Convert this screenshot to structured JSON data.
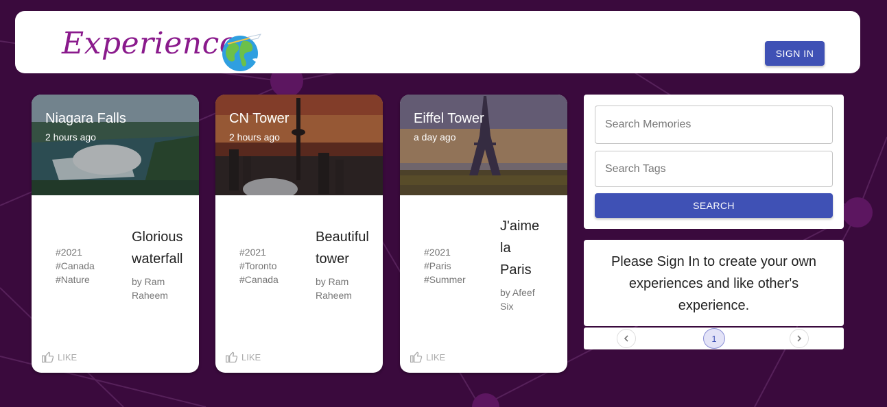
{
  "header": {
    "logo_text": "Experiences",
    "sign_in_label": "SIGN IN"
  },
  "posts": [
    {
      "title": "Niagara Falls",
      "time": "2 hours ago",
      "tags": [
        "#2021",
        "#Canada",
        "#Nature"
      ],
      "message_lines": [
        "Glorious",
        "waterfall"
      ],
      "author_lines": [
        "by Ram",
        "Raheem"
      ],
      "like_label": "LIKE"
    },
    {
      "title": "CN Tower",
      "time": "2 hours ago",
      "tags": [
        "#2021",
        "#Toronto",
        "#Canada"
      ],
      "message_lines": [
        "Beautiful",
        "tower"
      ],
      "author_lines": [
        "by Ram",
        "Raheem"
      ],
      "like_label": "LIKE"
    },
    {
      "title": "Eiffel Tower",
      "time": "a day ago",
      "tags": [
        "#2021",
        "#Paris",
        "#Summer"
      ],
      "message_lines": [
        "J'aime",
        "la",
        "Paris"
      ],
      "author_lines": [
        "by Afeef",
        "Six"
      ],
      "like_label": "LIKE"
    }
  ],
  "search": {
    "memories_placeholder": "Search Memories",
    "tags_placeholder": "Search Tags",
    "button_label": "SEARCH"
  },
  "signin_notice": {
    "lines": [
      "Please Sign In to create your own",
      "experiences and like other's",
      "experience."
    ]
  },
  "pagination": {
    "current_page": "1",
    "prev_icon": "chevron-left-icon",
    "next_icon": "chevron-right-icon"
  },
  "colors": {
    "background": "#3a0a3d",
    "primary": "#3f51b5",
    "logo": "#8a1a8c"
  }
}
